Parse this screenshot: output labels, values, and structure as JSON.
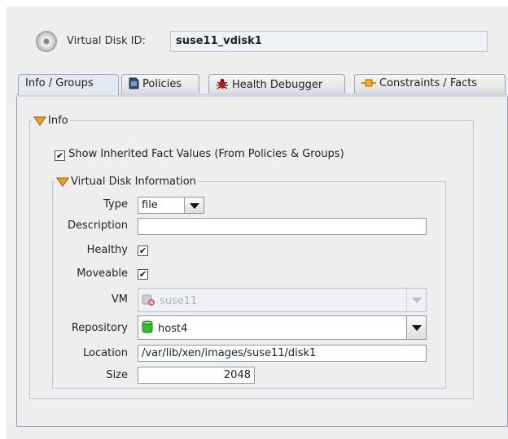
{
  "header": {
    "id_label": "Virtual Disk ID:",
    "id_value": "suse11_vdisk1"
  },
  "tabs": [
    {
      "label": "Info / Groups",
      "icon": "none",
      "active": true
    },
    {
      "label": "Policies",
      "icon": "document-icon"
    },
    {
      "label": "Health Debugger",
      "icon": "bug-icon"
    },
    {
      "label": "Constraints / Facts",
      "icon": "constraint-icon"
    }
  ],
  "info": {
    "legend": "Info",
    "show_inherited_label": "Show Inherited Fact Values (From Policies & Groups)",
    "show_inherited_checked": true
  },
  "vdisk": {
    "legend": "Virtual Disk Information",
    "type_label": "Type",
    "type_value": "file",
    "description_label": "Description",
    "description_value": "",
    "healthy_label": "Healthy",
    "healthy_checked": true,
    "moveable_label": "Moveable",
    "moveable_checked": true,
    "vm_label": "VM",
    "vm_value": "suse11",
    "repository_label": "Repository",
    "repository_value": "host4",
    "location_label": "Location",
    "location_value": "/var/lib/xen/images/suse11/disk1",
    "size_label": "Size",
    "size_value": "2048"
  },
  "colors": {
    "accent_orange": "#f0a020",
    "tab_border": "#9aa5b5",
    "repo_green": "#2fbf2f"
  },
  "check_mark": "✔"
}
